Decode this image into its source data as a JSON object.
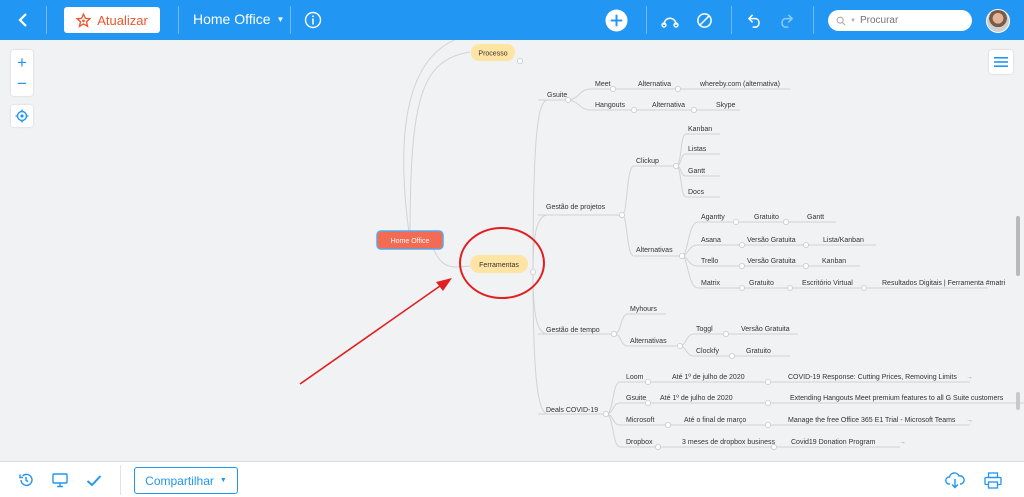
{
  "toolbar": {
    "update_label": "Atualizar",
    "doc_title": "Home Office",
    "search_placeholder": "Procurar"
  },
  "bottom": {
    "share_label": "Compartilhar"
  },
  "colors": {
    "primary": "#2196f3",
    "root_node": "#f26b52",
    "topic_node": "#ffe4a3",
    "annotation": "#e02020"
  },
  "mindmap": {
    "root": "Home Office",
    "topics": [
      "Processo",
      "Ferramentas"
    ],
    "g1": "Gsuite",
    "meet": "Meet",
    "alt": "Alternativa",
    "whereby": "whereby.com (alternativa)",
    "hangouts": "Hangouts",
    "skype": "Skype",
    "g2": "Gestão de projetos",
    "clickup": "Clickup",
    "clickup_items": [
      "Kanban",
      "Listas",
      "Gantt",
      "Docs"
    ],
    "alternativas": "Alternativas",
    "agantty": "Agantty",
    "gratuito": "Gratuito",
    "gantt": "Gantt",
    "asana": "Asana",
    "versao_gratuita": "Versão Gratuita",
    "lista_kanban": "Lista/Kanban",
    "trello": "Trello",
    "kanban": "Kanban",
    "matrix": "Matrix",
    "escritorio": "Escritório Virtual",
    "resultados": "Resultados Digitais | Ferramenta #matri",
    "g3": "Gestão de tempo",
    "myhours": "Myhours",
    "toggl": "Toggl",
    "clockfy": "Clockfy",
    "g4": "Deals COVID-19",
    "loom": "Loom",
    "loom_deal": "Até 1º de julho de 2020",
    "loom_link": "COVID-19 Response: Cutting Prices, Removing Limits",
    "gsuite": "Gsuite",
    "gsuite_deal": "Até 1º de julho de 2020",
    "gsuite_link": "Extending Hangouts Meet premium features to all G Suite customers",
    "microsoft": "Microsoft",
    "ms_deal": "Até o final de março",
    "ms_link": "Manage the free Office 365 E1 Trial - Microsoft Teams",
    "dropbox": "Dropbox",
    "dropbox_deal": "3 meses de dropbox business",
    "dropbox_link": "Covid19 Donation Program"
  }
}
